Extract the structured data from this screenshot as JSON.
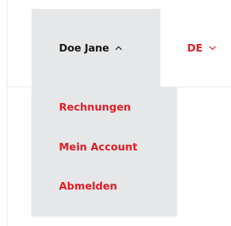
{
  "header": {
    "user_name": "Doe Jane",
    "user_chevron_icon": "chevron-up-icon",
    "language_label": "DE",
    "language_chevron_icon": "chevron-down-icon"
  },
  "user_menu": {
    "items": [
      {
        "label": "Rechnungen"
      },
      {
        "label": "Mein Account"
      },
      {
        "label": "Abmelden"
      }
    ]
  },
  "colors": {
    "accent": "#e31e24",
    "panel": "#e6e7e9",
    "text": "#1a1a1a"
  }
}
